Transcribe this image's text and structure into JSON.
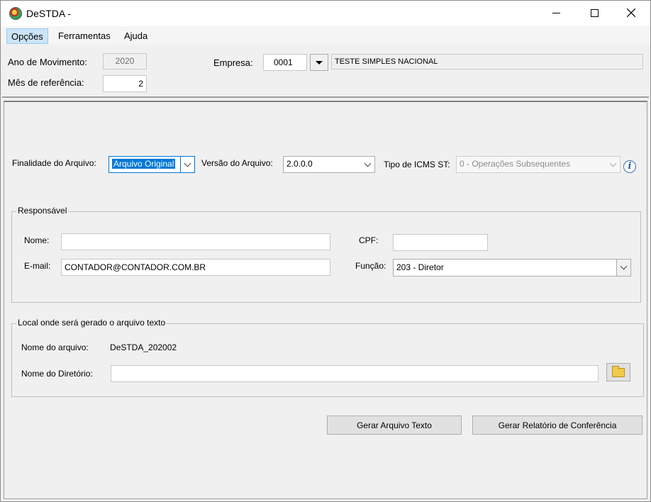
{
  "window": {
    "title": "DeSTDA -"
  },
  "menu": {
    "items": [
      "Opções",
      "Ferramentas",
      "Ajuda"
    ]
  },
  "top": {
    "ano_label": "Ano de Movimento:",
    "ano_value": "2020",
    "mes_label": "Mês de referência:",
    "mes_value": "2",
    "empresa_label": "Empresa:",
    "empresa_code": "0001",
    "empresa_name": "TESTE SIMPLES NACIONAL"
  },
  "main": {
    "finalidade_label": "Finalidade do Arquivo:",
    "finalidade_value": "Arquivo Original",
    "versao_label": "Versão do Arquivo:",
    "versao_value": "2.0.0.0",
    "tipo_icms_label": "Tipo de ICMS ST:",
    "tipo_icms_value": "0 - Operações Subsequentes",
    "info_glyph": "i"
  },
  "responsavel": {
    "title": "Responsável",
    "nome_label": "Nome:",
    "nome_value": "",
    "cpf_label": "CPF:",
    "cpf_value": "",
    "email_label": "E-mail:",
    "email_value": "CONTADOR@CONTADOR.COM.BR",
    "funcao_label": "Função:",
    "funcao_value": "203 - Diretor"
  },
  "local": {
    "title": "Local onde será gerado o arquivo texto",
    "arquivo_label": "Nome do arquivo:",
    "arquivo_value": "DeSTDA_202002",
    "diretorio_label": "Nome do Diretório:",
    "diretorio_value": ""
  },
  "actions": {
    "gerar_texto": "Gerar Arquivo Texto",
    "gerar_relatorio": "Gerar Relatório de Conferência"
  },
  "colors": {
    "accent": "#0078d7",
    "menu_active_bg": "#cce4f7",
    "window_bg": "#f0f0f0"
  },
  "icons": {
    "app": "app-logo-icon",
    "info": "info-icon",
    "folder": "folder-icon"
  }
}
